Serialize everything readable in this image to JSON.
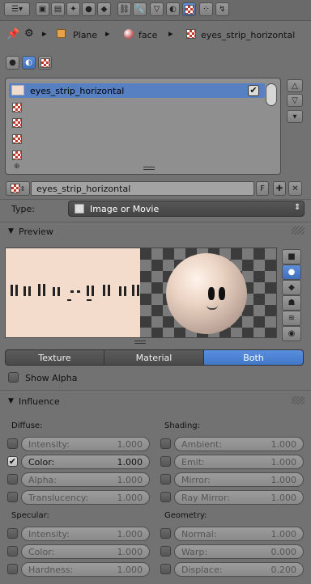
{
  "toolbar": {
    "icons": [
      "editor-type-icon",
      "render-icon",
      "render-layers-icon",
      "scene-icon",
      "world-icon",
      "object-icon",
      "constraints-icon",
      "modifiers-icon",
      "data-icon",
      "material-icon",
      "texture-icon",
      "particles-icon",
      "physics-icon"
    ],
    "active_icon": "texture-icon"
  },
  "breadcrumb": {
    "items": [
      "Plane",
      "face",
      "eyes_strip_horizontal"
    ]
  },
  "texture_slots": {
    "selected": "eyes_strip_horizontal",
    "slot_count": 5
  },
  "datablock": {
    "name": "eyes_strip_horizontal",
    "fake_user": "F"
  },
  "type": {
    "label": "Type:",
    "value": "Image or Movie"
  },
  "preview": {
    "title": "Preview",
    "tabs": [
      "Texture",
      "Material",
      "Both"
    ],
    "active_tab": "Both",
    "show_alpha": "Show Alpha"
  },
  "influence": {
    "title": "Influence",
    "diffuse": {
      "label": "Diffuse:",
      "items": [
        {
          "label": "Intensity:",
          "value": "1.000",
          "checked": false
        },
        {
          "label": "Color:",
          "value": "1.000",
          "checked": true
        },
        {
          "label": "Alpha:",
          "value": "1.000",
          "checked": false
        },
        {
          "label": "Translucency:",
          "value": "1.000",
          "checked": false
        }
      ]
    },
    "shading": {
      "label": "Shading:",
      "items": [
        {
          "label": "Ambient:",
          "value": "1.000",
          "checked": false
        },
        {
          "label": "Emit:",
          "value": "1.000",
          "checked": false
        },
        {
          "label": "Mirror:",
          "value": "1.000",
          "checked": false
        },
        {
          "label": "Ray Mirror:",
          "value": "1.000",
          "checked": false
        }
      ]
    },
    "specular": {
      "label": "Specular:",
      "items": [
        {
          "label": "Intensity:",
          "value": "1.000",
          "checked": false
        },
        {
          "label": "Color:",
          "value": "1.000",
          "checked": false
        },
        {
          "label": "Hardness:",
          "value": "1.000",
          "checked": false
        }
      ]
    },
    "geometry": {
      "label": "Geometry:",
      "items": [
        {
          "label": "Normal:",
          "value": "1.000",
          "checked": false
        },
        {
          "label": "Warp:",
          "value": "0.000",
          "checked": false
        },
        {
          "label": "Displace:",
          "value": "0.200",
          "checked": false
        }
      ]
    }
  }
}
